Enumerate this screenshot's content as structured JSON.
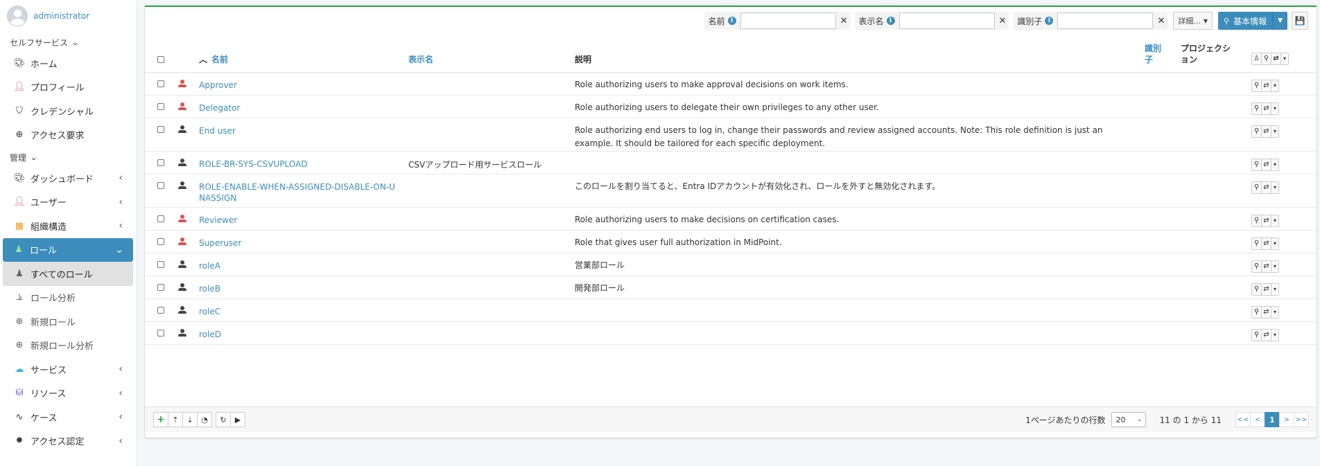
{
  "user": {
    "name": "administrator"
  },
  "sidebar": {
    "selfservice_label": "セルフサービス",
    "selfservice_items": [
      {
        "label": "ホーム",
        "icon": "palette-icon"
      },
      {
        "label": "プロフィール",
        "icon": "user-icon"
      },
      {
        "label": "クレデンシャル",
        "icon": "shield-icon"
      },
      {
        "label": "アクセス要求",
        "icon": "plus-circle-icon"
      }
    ],
    "admin_label": "管理",
    "admin_items": [
      {
        "label": "ダッシュボード",
        "icon": "palette-icon"
      },
      {
        "label": "ユーザー",
        "icon": "user-icon"
      },
      {
        "label": "組織構造",
        "icon": "building-icon"
      },
      {
        "label": "ロール",
        "icon": "role-icon"
      }
    ],
    "role_sub": [
      {
        "label": "すべてのロール"
      },
      {
        "label": "ロール分析"
      },
      {
        "label": "新規ロール"
      },
      {
        "label": "新規ロール分析"
      }
    ],
    "admin_items2": [
      {
        "label": "サービス",
        "icon": "cloud-icon"
      },
      {
        "label": "リソース",
        "icon": "database-icon"
      },
      {
        "label": "ケース",
        "icon": "route-icon"
      },
      {
        "label": "アクセス認定",
        "icon": "badge-icon"
      }
    ]
  },
  "search": {
    "name_label": "名前",
    "display_label": "表示名",
    "identifier_label": "識別子",
    "name_value": "",
    "display_value": "",
    "identifier_value": "",
    "more_label": "詳細...",
    "basic_label": "基本情報"
  },
  "table": {
    "headers": {
      "name": "名前",
      "display_name": "表示名",
      "description": "説明",
      "identifier": "識別子",
      "projection": "プロジェクション"
    },
    "rows": [
      {
        "icon_color": "red",
        "name": "Approver",
        "display": "",
        "desc": "Role authorizing users to make approval decisions on work items."
      },
      {
        "icon_color": "red",
        "name": "Delegator",
        "display": "",
        "desc": "Role authorizing users to delegate their own privileges to any other user."
      },
      {
        "icon_color": "gray",
        "name": "End user",
        "display": "",
        "desc": "Role authorizing end users to log in, change their passwords and review assigned accounts. Note: This role definition is just an example. It should be tailored for each specific deployment."
      },
      {
        "icon_color": "gray",
        "name": "ROLE-BR-SYS-CSVUPLOAD",
        "display": "CSVアップロード用サービスロール",
        "desc": ""
      },
      {
        "icon_color": "gray",
        "name": "ROLE-ENABLE-WHEN-ASSIGNED-DISABLE-ON-UNASSIGN",
        "display": "",
        "desc": "このロールを割り当てると、Entra IDアカウントが有効化され、ロールを外すと無効化されます。"
      },
      {
        "icon_color": "red",
        "name": "Reviewer",
        "display": "",
        "desc": "Role authorizing users to make decisions on certification cases."
      },
      {
        "icon_color": "red",
        "name": "Superuser",
        "display": "",
        "desc": "Role that gives user full authorization in MidPoint."
      },
      {
        "icon_color": "gray",
        "name": "roleA",
        "display": "",
        "desc": "営業部ロール"
      },
      {
        "icon_color": "gray",
        "name": "roleB",
        "display": "",
        "desc": "開発部ロール"
      },
      {
        "icon_color": "gray",
        "name": "roleC",
        "display": "",
        "desc": ""
      },
      {
        "icon_color": "gray",
        "name": "roleD",
        "display": "",
        "desc": ""
      }
    ]
  },
  "footer": {
    "rows_per_page_label": "1ページあたりの行数",
    "rows_per_page": "20",
    "range": "11 の 1 から 11",
    "pager": [
      "<<",
      "<",
      "1",
      ">",
      ">>"
    ],
    "current_page": "1"
  },
  "colors": {
    "accent": "#3c8dbc",
    "top_border": "#28a745",
    "red_role": "#d9534f"
  }
}
